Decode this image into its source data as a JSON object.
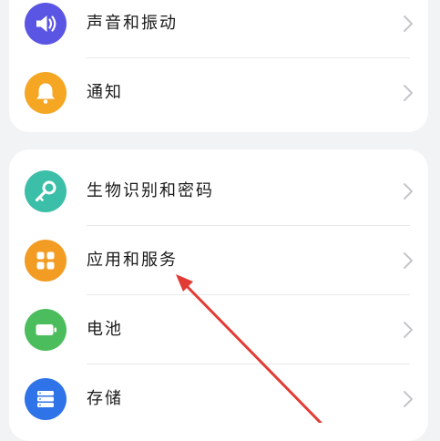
{
  "settings": {
    "group1": [
      {
        "label": "声音和振动",
        "icon": "speaker-icon",
        "icon_color": "#5b55e3"
      },
      {
        "label": "通知",
        "icon": "bell-icon",
        "icon_color": "#f5a623"
      }
    ],
    "group2": [
      {
        "label": "生物识别和密码",
        "icon": "key-icon",
        "icon_color": "#3bbfa8"
      },
      {
        "label": "应用和服务",
        "icon": "apps-grid-icon",
        "icon_color": "#f39c23"
      },
      {
        "label": "电池",
        "icon": "battery-icon",
        "icon_color": "#4cbd5c"
      },
      {
        "label": "存储",
        "icon": "storage-icon",
        "icon_color": "#2f73e8"
      }
    ]
  },
  "annotation": {
    "color": "#e23b34",
    "target": "应用和服务"
  }
}
